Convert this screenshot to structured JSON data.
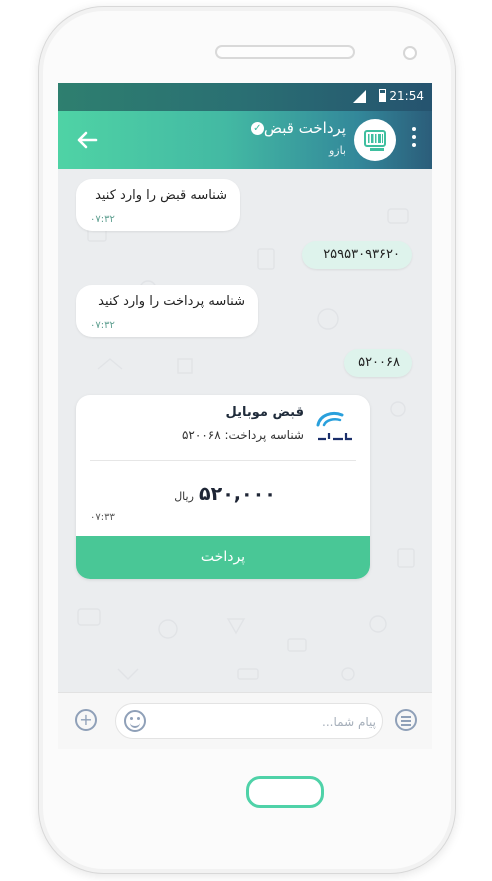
{
  "status_bar": {
    "time": "21:54"
  },
  "header": {
    "title": "پرداخت قبض",
    "subtitle": "بازو",
    "verified_icon": "check-badge-icon",
    "back_icon": "arrow-left-icon",
    "menu_icon": "more-vert-icon",
    "avatar_icon": "bill-barcode-icon"
  },
  "messages": [
    {
      "direction": "incoming",
      "text": "شناسه قبض را وارد کنید",
      "time": "۰۷:۳۲"
    },
    {
      "direction": "outgoing",
      "text": "۲۵۹۵۳۰۹۳۶۲۰"
    },
    {
      "direction": "incoming",
      "text": "شناسه پرداخت را وارد کنید",
      "time": "۰۷:۳۲"
    },
    {
      "direction": "outgoing",
      "text": "۵۲۰۰۶۸"
    }
  ],
  "bill_card": {
    "title": "قبض موبایل",
    "payment_id_line": "شناسه پرداخت: ۵۲۰۰۶۸",
    "amount": "۵۲۰,۰۰۰",
    "currency": "ریال",
    "time": "۰۷:۳۳",
    "pay_button_label": "پرداخت",
    "logo_icon": "operator-logo-icon"
  },
  "input_bar": {
    "placeholder": "پیام شما...",
    "value": ""
  },
  "colors": {
    "header_gradient_start": "#4fd3a5",
    "header_gradient_end": "#2b5d7a",
    "pay_button": "#49c796",
    "outgoing_bubble": "#def3ec",
    "incoming_bubble": "#ffffff",
    "chat_background": "#ebedef",
    "home_button_ring": "#4fd2a8"
  }
}
